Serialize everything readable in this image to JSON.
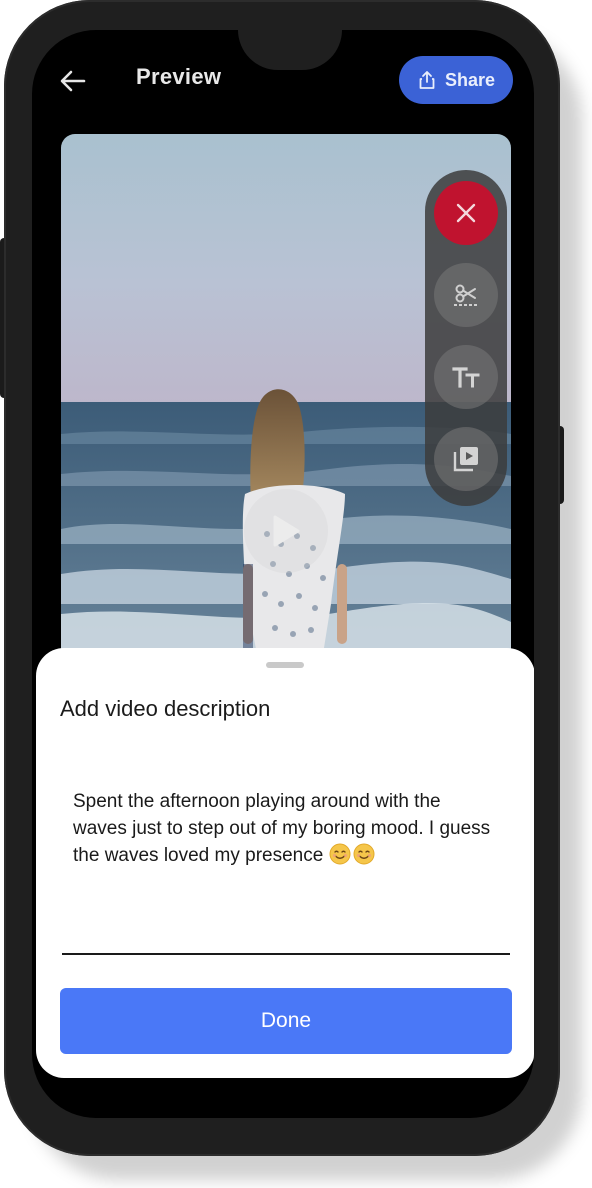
{
  "header": {
    "back_icon": "arrow-left-icon",
    "title": "Preview",
    "share_label": "Share",
    "share_icon": "share-upload-icon",
    "share_color": "#3b62d6"
  },
  "video": {
    "play_icon": "play-icon",
    "tools": [
      {
        "name": "close-icon",
        "color": "#c0132f"
      },
      {
        "name": "trim-scissors-icon"
      },
      {
        "name": "text-icon"
      },
      {
        "name": "media-library-icon"
      }
    ]
  },
  "sheet": {
    "title": "Add video description",
    "description": "Spent the afternoon playing around with the waves just to step out of my boring mood. I guess the waves loved my presence",
    "emojis": [
      "smiling-face-emoji",
      "smiling-face-emoji"
    ],
    "done_label": "Done",
    "done_color": "#4a78f7"
  }
}
